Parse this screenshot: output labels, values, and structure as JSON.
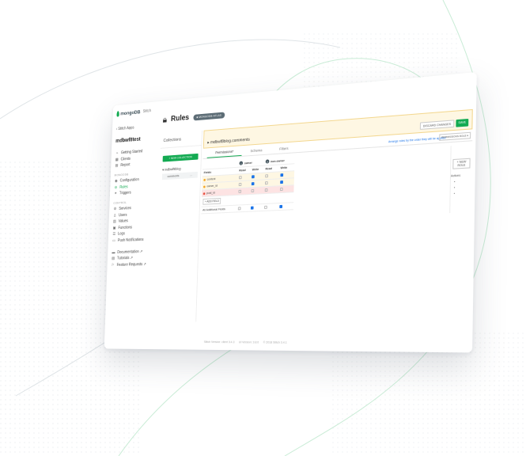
{
  "sidebar": {
    "logo_text": "mongoDB",
    "logo_sub": "Stitch",
    "back_label": "Stitch Apps",
    "app_name": "mdbwf8test",
    "top_items": [
      {
        "label": "Getting Started",
        "icon": "getting-started-icon",
        "glyph": "⌁"
      },
      {
        "label": "Clients",
        "icon": "clients-icon",
        "glyph": "▦"
      },
      {
        "label": "Report",
        "icon": "report-icon",
        "glyph": "▤"
      }
    ],
    "mongodb_head": "MONGODB",
    "mongodb_items": [
      {
        "label": "Configuration",
        "icon": "configuration-icon",
        "glyph": "◉"
      },
      {
        "label": "Rules",
        "icon": "rules-icon",
        "glyph": "⊖"
      },
      {
        "label": "Triggers",
        "icon": "triggers-icon",
        "glyph": "✦"
      }
    ],
    "control_head": "CONTROL",
    "control_items": [
      {
        "label": "Services",
        "icon": "services-icon",
        "glyph": "⚙"
      },
      {
        "label": "Users",
        "icon": "users-icon",
        "glyph": "♙"
      },
      {
        "label": "Values",
        "icon": "values-icon",
        "glyph": "▥"
      },
      {
        "label": "Functions",
        "icon": "functions-icon",
        "glyph": "▣"
      },
      {
        "label": "Logs",
        "icon": "logs-icon",
        "glyph": "☰"
      },
      {
        "label": "Push Notifications",
        "icon": "push-notifications-icon",
        "glyph": "▭"
      }
    ],
    "help_items": [
      {
        "label": "Documentation ↗",
        "icon": "documentation-icon",
        "glyph": "▬"
      },
      {
        "label": "Tutorials ↗",
        "icon": "tutorials-icon",
        "glyph": "▤"
      },
      {
        "label": "Feature Requests ↗",
        "icon": "feature-requests-icon",
        "glyph": "⚐"
      }
    ]
  },
  "header": {
    "title": "Rules",
    "badge": "■ MONGODB-ATLAS"
  },
  "collections": {
    "heading": "Collections",
    "add_button": "+ NEW COLLECTION",
    "database": "mdbwf8blog",
    "collection": "comments"
  },
  "panel": {
    "path": "mdbwf8blog.comments",
    "discard_label": "DISCARD CHANGES",
    "save_label": "SAVE",
    "tabs": [
      "Permissions*",
      "Schema",
      "Filters"
    ],
    "note": "Arrange roles by the order they will be applied",
    "order_button": "PERMISSIONS ROLE ▾",
    "roles": [
      {
        "name": "owner",
        "initial": "1"
      },
      {
        "name": "non-owner",
        "initial": "2"
      }
    ],
    "col_read": "Read",
    "col_write": "Write",
    "fields_header": "Fields",
    "rows": [
      {
        "field": "content",
        "dot": "#f5a623",
        "kind": "warn"
      },
      {
        "field": "owner_id",
        "dot": "#f5a623",
        "kind": "warn"
      },
      {
        "field": "post_id",
        "dot": "#e74c3c",
        "kind": "err"
      }
    ],
    "add_field": "+ ADD FIELD",
    "all_fields": "All Additional Fields",
    "add_role": "+ NEW ROLE",
    "actions_header": "Actions"
  },
  "footer": {
    "items": [
      "Stitch Version: client 3.4.3",
      "UI Version: 3.8.0",
      "© 2018 Stitch 3.4.1"
    ]
  },
  "colors": {
    "accent": "#13aa52",
    "link": "#1a73e8",
    "warning_bg": "#fef7e3",
    "error_bg": "#fde3e3"
  }
}
